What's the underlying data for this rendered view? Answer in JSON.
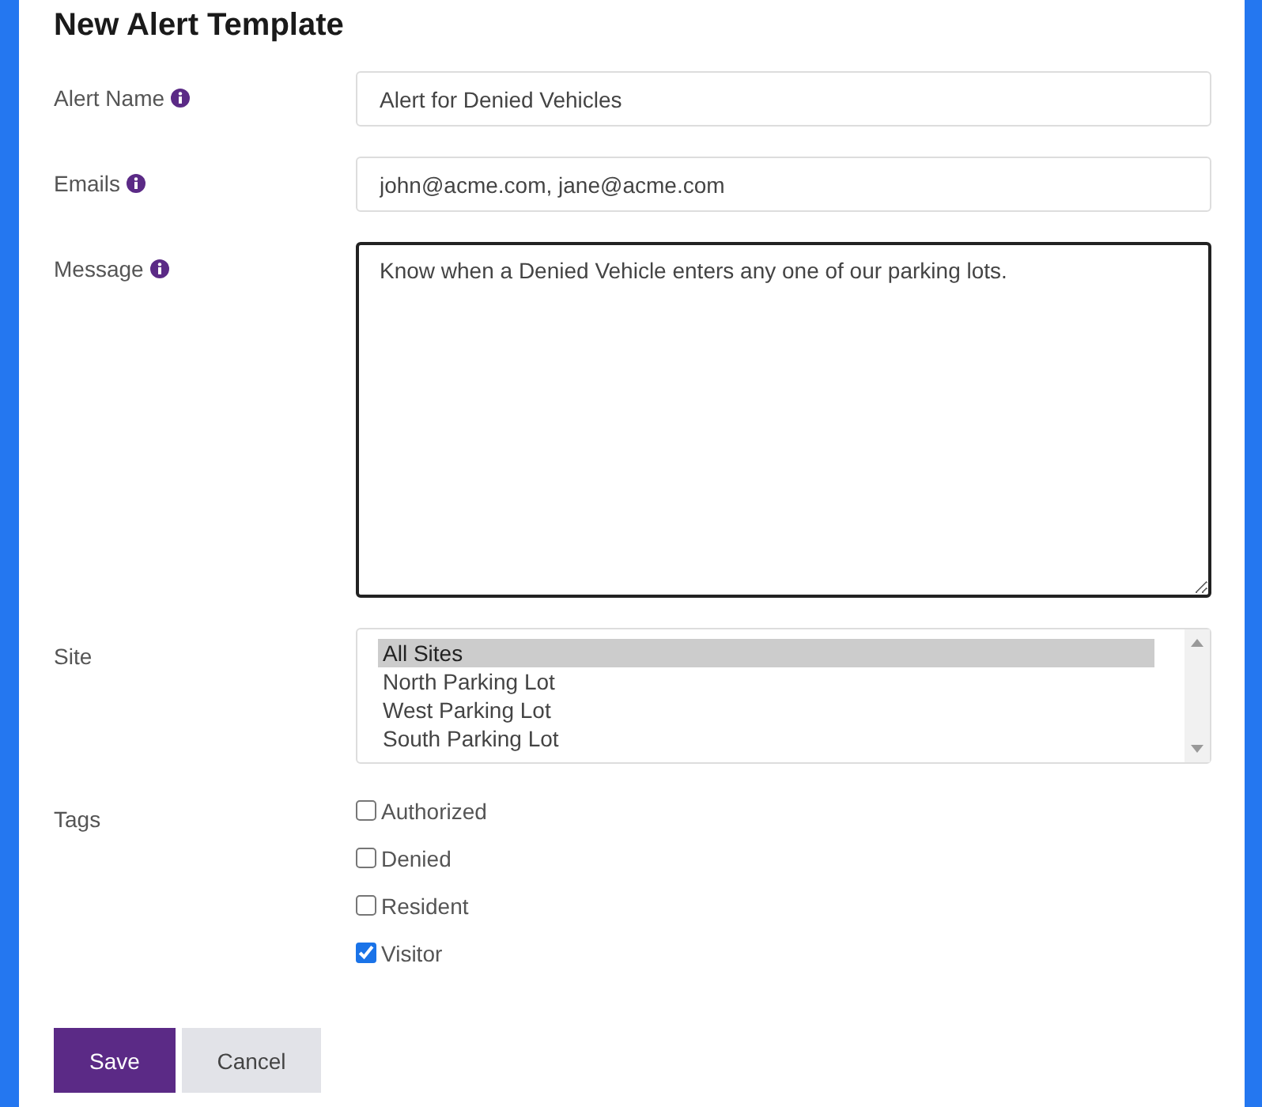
{
  "title": "New Alert Template",
  "fields": [
    {
      "kind": "text",
      "label": "Alert Name",
      "info": true,
      "value": "Alert for Denied Vehicles",
      "focused": false
    },
    {
      "kind": "text",
      "label": "Emails",
      "info": true,
      "value": "john@acme.com, jane@acme.com",
      "focused": false
    },
    {
      "kind": "textarea",
      "label": "Message",
      "info": true,
      "value": "Know when a Denied Vehicle enters any one of our parking lots.",
      "focused": true
    }
  ],
  "site": {
    "label": "Site",
    "options": [
      {
        "label": "All Sites",
        "selected": true
      },
      {
        "label": "North Parking Lot",
        "selected": false
      },
      {
        "label": "West Parking Lot",
        "selected": false
      },
      {
        "label": "South Parking Lot",
        "selected": false
      }
    ]
  },
  "tags": {
    "label": "Tags",
    "options": [
      {
        "label": "Authorized",
        "checked": false
      },
      {
        "label": "Denied",
        "checked": false
      },
      {
        "label": "Resident",
        "checked": false
      },
      {
        "label": "Visitor",
        "checked": true
      }
    ]
  },
  "buttons": [
    {
      "label": "Save",
      "kind": "primary"
    },
    {
      "label": "Cancel",
      "kind": "secondary"
    }
  ]
}
